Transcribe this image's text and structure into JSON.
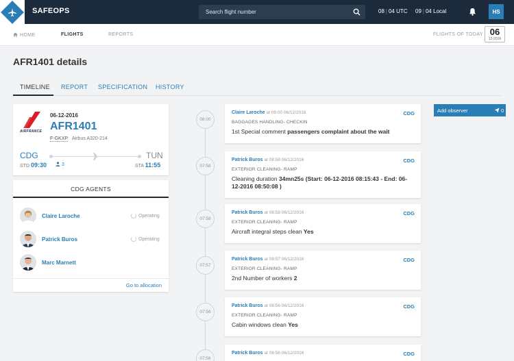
{
  "app": {
    "brand": "SAFEOPS",
    "search_placeholder": "Search flight number",
    "user_initials": "HS"
  },
  "clock": {
    "utc_h": "08",
    "utc_m": "04",
    "utc_label": "UTC",
    "local_h": "09",
    "local_m": "04",
    "local_label": "Local"
  },
  "nav": {
    "home": "HOME",
    "flights": "FLIGHTS",
    "reports": "REPORTS",
    "flights_today": "FLIGHTS OF TODAY",
    "cal_day": "06",
    "cal_date": "12-2016"
  },
  "page": {
    "title": "AFR1401 details"
  },
  "tabs": [
    "TIMELINE",
    "REPORT",
    "SPECIFICATION",
    "HISTORY"
  ],
  "flight": {
    "airline_text": "AIRFRANCE",
    "date": "06-12-2016",
    "number": "AFR1401",
    "registration": "F-GKXP",
    "aircraft": "Airbus A320-214",
    "from": "CDG",
    "to": "TUN",
    "std_label": "STD",
    "std": "09:30",
    "sta_label": "STA",
    "sta": "11:55",
    "pax": "3"
  },
  "agents": {
    "title": "CDG AGENTS",
    "list": [
      {
        "name": "Claire Laroche",
        "status": "Operating"
      },
      {
        "name": "Patrick Buros",
        "status": "Operating"
      },
      {
        "name": "Marc Marnett",
        "status": ""
      }
    ],
    "footer_link": "Go to allocation"
  },
  "observer": {
    "label": "Add observer",
    "count": "0"
  },
  "timeline": [
    {
      "time": "08:00",
      "who": "Claire Laroche",
      "when": "at 09:00 06/12/2016",
      "loc": "CDG",
      "cat": "BAGGAGES HANDLING- CHECKIN",
      "text_pre": "1st Special comment ",
      "text_bold": "passengers complaint about the wait"
    },
    {
      "time": "07:58",
      "who": "Patrick Buros",
      "when": "at 08:58 06/12/2016",
      "loc": "CDG",
      "cat": "EXTERIOR CLEANING- RAMP",
      "text_pre": "Cleaning duration ",
      "text_bold": "34mn25s (Start: 06-12-2016 08:15:43 - End: 06-12-2016 08:50:08 )"
    },
    {
      "time": "07:58",
      "who": "Patrick Buros",
      "when": "at 08:58 06/12/2016",
      "loc": "CDG",
      "cat": "EXTERIOR CLEANING- RAMP",
      "text_pre": "Aircraft integral steps clean ",
      "text_bold": "Yes"
    },
    {
      "time": "07:57",
      "who": "Patrick Buros",
      "when": "at 08:57 06/12/2016",
      "loc": "CDG",
      "cat": "EXTERIOR CLEANING- RAMP",
      "text_pre": "2nd Number of workers ",
      "text_bold": "2"
    },
    {
      "time": "07:56",
      "who": "Patrick Buros",
      "when": "at 08:56 06/12/2016",
      "loc": "CDG",
      "cat": "EXTERIOR CLEANING- RAMP",
      "text_pre": "Cabin windows clean ",
      "text_bold": "Yes"
    },
    {
      "time": "07:56",
      "who": "Patrick Buros",
      "when": "at 08:56 06/12/2016",
      "loc": "CDG",
      "cat": "",
      "text_pre": "",
      "text_bold": ""
    }
  ]
}
